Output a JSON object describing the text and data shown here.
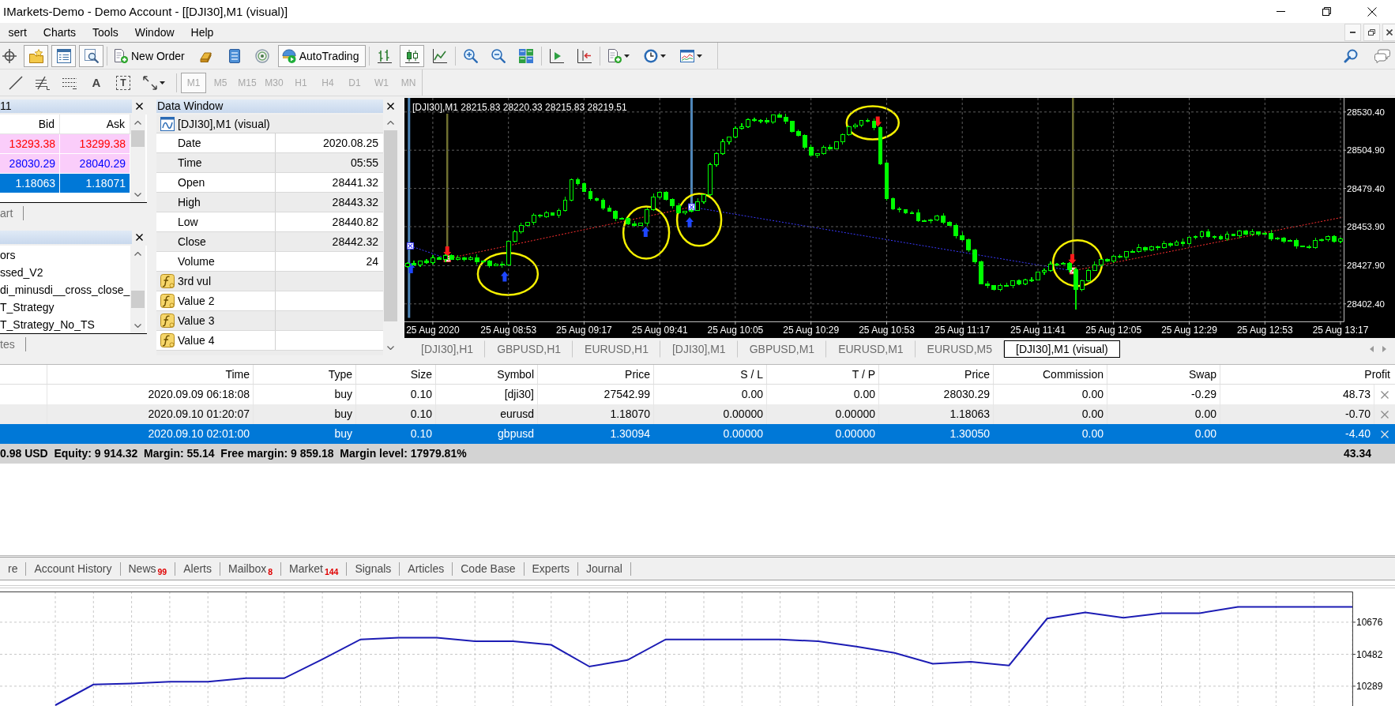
{
  "window": {
    "title": "IMarkets-Demo - Demo Account - [[DJI30],M1 (visual)]"
  },
  "menu": [
    "sert",
    "Charts",
    "Tools",
    "Window",
    "Help"
  ],
  "toolbar": [
    [
      {
        "kind": "icon",
        "pressed": false
      },
      {
        "kind": "icon",
        "pressed": true
      },
      {
        "kind": "icon",
        "pressed": true
      },
      {
        "kind": "icon",
        "pressed": true
      }
    ],
    [
      {
        "kind": "labeled",
        "label": "New Order",
        "pressed": false
      },
      {
        "kind": "icon",
        "pressed": false
      },
      {
        "kind": "icon",
        "pressed": false
      },
      {
        "kind": "icon",
        "pressed": false
      },
      {
        "kind": "labeled",
        "label": "AutoTrading",
        "pressed": true
      }
    ],
    [
      {
        "kind": "icon",
        "pressed": false
      },
      {
        "kind": "icon",
        "pressed": true
      },
      {
        "kind": "icon",
        "pressed": false
      }
    ],
    [
      {
        "kind": "icon",
        "pressed": false
      },
      {
        "kind": "icon",
        "pressed": false
      },
      {
        "kind": "icon",
        "pressed": false
      }
    ],
    [
      {
        "kind": "icon",
        "pressed": false
      },
      {
        "kind": "icon",
        "pressed": false
      }
    ],
    [
      {
        "kind": "dropdown",
        "pressed": false
      },
      {
        "kind": "dropdown",
        "pressed": false
      },
      {
        "kind": "dropdown",
        "pressed": false
      }
    ]
  ],
  "drawing_tools": [
    {
      "kind": "icon"
    },
    {
      "kind": "icon"
    },
    {
      "kind": "icon"
    },
    {
      "kind": "glyph",
      "text": "A"
    },
    {
      "kind": "boxed_glyph",
      "text": "T"
    },
    {
      "kind": "dropdown"
    }
  ],
  "periods": [
    {
      "label": "M1",
      "selected": true,
      "disabled": true
    },
    {
      "label": "M5",
      "selected": false,
      "disabled": true
    },
    {
      "label": "M15",
      "selected": false,
      "disabled": true
    },
    {
      "label": "M30",
      "selected": false,
      "disabled": true
    },
    {
      "label": "H1",
      "selected": false,
      "disabled": true
    },
    {
      "label": "H4",
      "selected": false,
      "disabled": true
    },
    {
      "label": "D1",
      "selected": false,
      "disabled": true
    },
    {
      "label": "W1",
      "selected": false,
      "disabled": true
    },
    {
      "label": "MN",
      "selected": false,
      "disabled": true
    }
  ],
  "market_watch": {
    "title": "11",
    "columns": [
      "Bid",
      "Ask"
    ],
    "rows": [
      {
        "bid": "13293.38",
        "ask": "13299.38",
        "color": "#ff0000",
        "highlighted": true,
        "selected": false
      },
      {
        "bid": "28030.29",
        "ask": "28040.29",
        "color": "#0000ff",
        "highlighted": true,
        "selected": false
      },
      {
        "bid": "1.18063",
        "ask": "1.18071",
        "selected": true
      }
    ],
    "tab": "art"
  },
  "navigator": {
    "items": [
      {
        "label": "ors",
        "selected": false
      },
      {
        "label": "ssed_V2",
        "selected": false
      },
      {
        "label": "di_minusdi__cross_close_",
        "selected": false
      },
      {
        "label": "T_Strategy",
        "selected": false
      },
      {
        "label": "T_Strategy_No_TS",
        "selected": false
      }
    ],
    "tab": "tes"
  },
  "data_window": {
    "title": "Data Window",
    "header": "[DJI30],M1 (visual)",
    "rows": [
      {
        "kind": "field",
        "name": "Date",
        "value": "2020.08.25"
      },
      {
        "kind": "field",
        "name": "Time",
        "value": "05:55"
      },
      {
        "kind": "field",
        "name": "Open",
        "value": "28441.32"
      },
      {
        "kind": "field",
        "name": "High",
        "value": "28443.32"
      },
      {
        "kind": "field",
        "name": "Low",
        "value": "28440.82"
      },
      {
        "kind": "field",
        "name": "Close",
        "value": "28442.32"
      },
      {
        "kind": "field",
        "name": "Volume",
        "value": "24"
      },
      {
        "kind": "indicator",
        "name": "3rd vul"
      },
      {
        "kind": "indicator",
        "name": "Value 2"
      },
      {
        "kind": "indicator",
        "name": "Value 3"
      },
      {
        "kind": "indicator",
        "name": "Value 4"
      }
    ]
  },
  "chart": {
    "chart_data": {
      "type": "candlestick",
      "title": "[DJI30],M1 28215.83 28220.33 28215.83 28219.51",
      "grid": true,
      "ylim": [
        28390.7,
        28539.8
      ],
      "yticks": [
        {
          "value": 28530.4,
          "label": "28530.40"
        },
        {
          "value": 28504.9,
          "label": "28504.90"
        },
        {
          "value": 28479.4,
          "label": "28479.40"
        },
        {
          "value": 28453.9,
          "label": "28453.90"
        },
        {
          "value": 28427.9,
          "label": "28427.90"
        },
        {
          "value": 28402.4,
          "label": "28402.40"
        }
      ],
      "categories": [
        null,
        null,
        null,
        null,
        "25 Aug 2020",
        null,
        null,
        null,
        null,
        null,
        null,
        null,
        null,
        null,
        null,
        null,
        "25 Aug 08:53",
        null,
        null,
        null,
        null,
        null,
        null,
        null,
        null,
        null,
        null,
        null,
        "25 Aug 09:17",
        null,
        null,
        null,
        null,
        null,
        null,
        null,
        null,
        null,
        null,
        null,
        "25 Aug 09:41",
        null,
        null,
        null,
        null,
        null,
        null,
        null,
        null,
        null,
        null,
        null,
        "25 Aug 10:05",
        null,
        null,
        null,
        null,
        null,
        null,
        null,
        null,
        null,
        null,
        null,
        "25 Aug 10:29",
        null,
        null,
        null,
        null,
        null,
        null,
        null,
        null,
        null,
        null,
        null,
        "25 Aug 10:53",
        null,
        null,
        null,
        null,
        null,
        null,
        null,
        null,
        null,
        null,
        null,
        "25 Aug 11:17",
        null,
        null,
        null,
        null,
        null,
        null,
        null,
        null,
        null,
        null,
        null,
        "25 Aug 11:41",
        null,
        null,
        null,
        null,
        null,
        null,
        null,
        null,
        null,
        null,
        null,
        "25 Aug 12:05",
        null,
        null,
        null,
        null,
        null,
        null,
        null,
        null,
        null,
        null,
        null,
        "25 Aug 12:29",
        null,
        null,
        null,
        null,
        null,
        null,
        null,
        null,
        null,
        null,
        null,
        "25 Aug 12:53",
        null,
        null,
        null,
        null,
        null,
        null,
        null,
        null,
        null,
        null,
        null,
        "25 Aug 13:17"
      ],
      "ohlc": [
        [
          28427.5,
          28430.4,
          28426.4,
          28429.6
        ],
        [
          28429.6,
          28431.2,
          28428.1,
          28428.6
        ],
        [
          28428.6,
          28431.5,
          28426.9,
          28431.1
        ],
        [
          28431.1,
          28432.3,
          28429.2,
          28430.0
        ],
        [
          28430.0,
          28435.2,
          28428.7,
          28433.1
        ],
        [
          28433.1,
          28433.7,
          28431.8,
          28432.2
        ],
        [
          28432.2,
          28435.5,
          28430.3,
          28434.5
        ],
        [
          28434.5,
          28435.3,
          28431.6,
          28432.3
        ],
        [
          28432.3,
          28434.9,
          28431.3,
          28433.3
        ],
        [
          28433.3,
          28433.7,
          28430.8,
          28431.9
        ],
        [
          28431.9,
          28434.6,
          28431.4,
          28433.4
        ],
        [
          28433.4,
          28435.5,
          28428.7,
          28430.4
        ],
        [
          28430.4,
          28431.5,
          28429.6,
          28430.9
        ],
        [
          28430.9,
          28431.9,
          28426.6,
          28427.9
        ],
        [
          28427.9,
          28429.9,
          28427.5,
          28429.1
        ],
        [
          28429.1,
          28430.7,
          28426.3,
          28428.2
        ],
        [
          28428.2,
          28444.7,
          28427.5,
          28444.3
        ],
        [
          28444.3,
          28451.7,
          28443.3,
          28450.5
        ],
        [
          28450.5,
          28456.6,
          28449.4,
          28454.5
        ],
        [
          28454.5,
          28457.2,
          28454.0,
          28456.6
        ],
        [
          28456.6,
          28462.7,
          28454.9,
          28461.7
        ],
        [
          28461.7,
          28462.5,
          28460.0,
          28460.8
        ],
        [
          28460.8,
          28464.6,
          28459.5,
          28463.0
        ],
        [
          28463.0,
          28463.4,
          28461.3,
          28461.7
        ],
        [
          28461.7,
          28466.0,
          28459.8,
          28464.8
        ],
        [
          28464.8,
          28473.9,
          28464.1,
          28471.8
        ],
        [
          28471.8,
          28486.1,
          28470.8,
          28485.5
        ],
        [
          28485.5,
          28486.5,
          28481.6,
          28482.7
        ],
        [
          28482.7,
          28483.5,
          28477.1,
          28477.6
        ],
        [
          28477.6,
          28479.2,
          28471.2,
          28472.9
        ],
        [
          28472.9,
          28473.3,
          28470.9,
          28471.7
        ],
        [
          28471.7,
          28472.9,
          28465.0,
          28466.3
        ],
        [
          28466.3,
          28468.4,
          28464.0,
          28464.4
        ],
        [
          28464.4,
          28465.0,
          28457.4,
          28459.3
        ],
        [
          28459.3,
          28460.4,
          28458.6,
          28459.4
        ],
        [
          28459.4,
          28460.2,
          28454.8,
          28455.8
        ],
        [
          28455.8,
          28457.4,
          28453.8,
          28454.9
        ],
        [
          28454.9,
          28456.8,
          28454.4,
          28456.4
        ],
        [
          28456.4,
          28466.6,
          28454.7,
          28465.4
        ],
        [
          28465.4,
          28475.9,
          28464.6,
          28473.8
        ],
        [
          28473.8,
          28477.5,
          28472.5,
          28476.9
        ],
        [
          28476.9,
          28477.9,
          28471.5,
          28471.9
        ],
        [
          28471.9,
          28472.7,
          28466.2,
          28468.1
        ],
        [
          28468.1,
          28469.7,
          28462.4,
          28463.1
        ],
        [
          28463.1,
          28464.7,
          28462.1,
          28464.3
        ],
        [
          28464.3,
          28466.2,
          28463.2,
          28465.0
        ],
        [
          28465.0,
          28472.9,
          28464.5,
          28470.8
        ],
        [
          28470.8,
          28475.8,
          28469.1,
          28475.2
        ],
        [
          28475.2,
          28496.4,
          28474.4,
          28495.4
        ],
        [
          28495.4,
          28503.3,
          28494.1,
          28502.5
        ],
        [
          28502.5,
          28512.3,
          28502.1,
          28510.7
        ],
        [
          28510.7,
          28514.2,
          28508.8,
          28513.8
        ],
        [
          28513.8,
          28520.7,
          28513.1,
          28519.5
        ],
        [
          28519.5,
          28522.8,
          28518.5,
          28520.7
        ],
        [
          28520.7,
          28526.0,
          28519.6,
          28525.4
        ],
        [
          28525.4,
          28526.4,
          28524.1,
          28524.6
        ],
        [
          28524.6,
          28525.8,
          28522.9,
          28525.0
        ],
        [
          28525.0,
          28526.6,
          28522.7,
          28523.5
        ],
        [
          28523.5,
          28528.9,
          28522.2,
          28528.5
        ],
        [
          28528.5,
          28529.7,
          28526.6,
          28527.0
        ],
        [
          28527.0,
          28529.1,
          28522.3,
          28524.2
        ],
        [
          28524.2,
          28524.8,
          28516.9,
          28517.6
        ],
        [
          28517.6,
          28518.6,
          28513.8,
          28514.8
        ],
        [
          28514.8,
          28515.6,
          28505.8,
          28506.9
        ],
        [
          28506.9,
          28508.5,
          28501.0,
          28501.5
        ],
        [
          28501.5,
          28503.2,
          28499.8,
          28502.8
        ],
        [
          28502.8,
          28508.0,
          28502.0,
          28506.8
        ],
        [
          28506.8,
          28508.9,
          28504.5,
          28505.8
        ],
        [
          28505.8,
          28511.1,
          28505.4,
          28510.5
        ],
        [
          28510.5,
          28516.2,
          28508.6,
          28515.2
        ],
        [
          28515.2,
          28521.3,
          28514.5,
          28520.5
        ],
        [
          28520.5,
          28523.2,
          28519.5,
          28521.6
        ],
        [
          28521.6,
          28525.1,
          28520.5,
          28524.7
        ],
        [
          28524.7,
          28525.9,
          28523.7,
          28524.2
        ],
        [
          28524.2,
          28526.3,
          28518.4,
          28520.1
        ],
        [
          28520.1,
          28520.7,
          28495.3,
          28496.1
        ],
        [
          28496.1,
          28497.1,
          28471.4,
          28472.7
        ],
        [
          28472.7,
          28473.5,
          28465.2,
          28465.6
        ],
        [
          28465.6,
          28467.2,
          28463.3,
          28465.2
        ],
        [
          28465.2,
          28465.6,
          28462.5,
          28463.2
        ],
        [
          28463.2,
          28464.6,
          28462.2,
          28463.4
        ],
        [
          28463.4,
          28465.5,
          28457.0,
          28458.1
        ],
        [
          28458.1,
          28458.7,
          28457.5,
          28458.0
        ],
        [
          28458.0,
          28459.2,
          28456.3,
          28458.2
        ],
        [
          28458.2,
          28461.9,
          28457.4,
          28461.1
        ],
        [
          28461.1,
          28462.7,
          28455.7,
          28457.0
        ],
        [
          28457.0,
          28457.4,
          28454.5,
          28454.9
        ],
        [
          28454.9,
          28456.1,
          28446.2,
          28448.1
        ],
        [
          28448.1,
          28450.2,
          28444.5,
          28445.2
        ],
        [
          28445.2,
          28445.8,
          28437.3,
          28438.3
        ],
        [
          28438.3,
          28439.3,
          28429.4,
          28430.5
        ],
        [
          28430.5,
          28431.3,
          28415.4,
          28415.9
        ],
        [
          28415.9,
          28417.5,
          28413.0,
          28414.7
        ],
        [
          28414.7,
          28415.1,
          28411.5,
          28412.3
        ],
        [
          28412.3,
          28415.8,
          28411.0,
          28414.6
        ],
        [
          28414.6,
          28416.7,
          28414.1,
          28414.5
        ],
        [
          28414.5,
          28418.2,
          28412.6,
          28417.6
        ],
        [
          28417.6,
          28418.6,
          28415.2,
          28415.9
        ],
        [
          28415.9,
          28419.0,
          28414.9,
          28418.2
        ],
        [
          28418.2,
          28420.1,
          28417.1,
          28418.5
        ],
        [
          28418.5,
          28424.0,
          28418.0,
          28423.6
        ],
        [
          28423.6,
          28425.8,
          28421.9,
          28424.6
        ],
        [
          28424.6,
          28431.0,
          28423.8,
          28428.9
        ],
        [
          28428.9,
          28429.5,
          28427.5,
          28428.8
        ],
        [
          28428.8,
          28430.5,
          28428.4,
          28429.5
        ],
        [
          28429.5,
          28430.3,
          28423.2,
          28425.1
        ],
        [
          28425.1,
          28426.7,
          28398.5,
          28412.0
        ],
        [
          28412.0,
          28418.4,
          28411.0,
          28418.0
        ],
        [
          28418.0,
          28425.9,
          28416.9,
          28424.7
        ],
        [
          28424.7,
          28430.7,
          28424.2,
          28428.6
        ],
        [
          28428.6,
          28432.5,
          28426.9,
          28431.9
        ],
        [
          28431.9,
          28432.9,
          28430.4,
          28431.2
        ],
        [
          28431.2,
          28434.9,
          28429.9,
          28434.1
        ],
        [
          28434.1,
          28435.7,
          28433.1,
          28433.5
        ],
        [
          28433.5,
          28437.7,
          28431.6,
          28437.3
        ],
        [
          28437.3,
          28438.6,
          28436.6,
          28437.4
        ],
        [
          28437.4,
          28442.1,
          28436.4,
          28440.0
        ],
        [
          28440.0,
          28440.6,
          28437.1,
          28438.2
        ],
        [
          28438.2,
          28441.3,
          28437.7,
          28440.3
        ],
        [
          28440.3,
          28441.1,
          28438.3,
          28440.0
        ],
        [
          28440.0,
          28444.4,
          28439.2,
          28442.8
        ],
        [
          28442.8,
          28443.2,
          28440.2,
          28441.5
        ],
        [
          28441.5,
          28445.1,
          28441.1,
          28443.9
        ],
        [
          28443.9,
          28446.0,
          28440.8,
          28442.7
        ],
        [
          28442.7,
          28447.3,
          28442.0,
          28446.7
        ],
        [
          28446.7,
          28448.1,
          28445.7,
          28447.1
        ],
        [
          28447.1,
          28451.5,
          28446.0,
          28450.7
        ],
        [
          28450.7,
          28452.3,
          28446.6,
          28447.1
        ],
        [
          28447.1,
          28448.0,
          28445.4,
          28447.6
        ],
        [
          28447.6,
          28448.8,
          28444.8,
          28445.6
        ],
        [
          28445.6,
          28450.8,
          28444.3,
          28448.7
        ],
        [
          28448.7,
          28449.3,
          28447.6,
          28448.0
        ],
        [
          28448.0,
          28452.0,
          28446.1,
          28451.0
        ],
        [
          28451.0,
          28451.8,
          28448.0,
          28448.7
        ],
        [
          28448.7,
          28452.2,
          28447.7,
          28450.6
        ],
        [
          28450.6,
          28451.0,
          28447.7,
          28448.8
        ],
        [
          28448.8,
          28450.9,
          28448.3,
          28449.7
        ],
        [
          28449.7,
          28451.8,
          28444.3,
          28446.0
        ],
        [
          28446.0,
          28446.9,
          28445.2,
          28446.3
        ],
        [
          28446.3,
          28447.3,
          28443.0,
          28444.3
        ],
        [
          28444.3,
          28445.4,
          28443.9,
          28444.6
        ],
        [
          28444.6,
          28446.2,
          28439.0,
          28440.9
        ],
        [
          28440.9,
          28441.3,
          28440.0,
          28440.7
        ],
        [
          28440.7,
          28441.9,
          28439.1,
          28440.1
        ],
        [
          28440.1,
          28446.6,
          28439.0,
          28444.5
        ],
        [
          28444.5,
          28446.0,
          28444.0,
          28445.4
        ],
        [
          28445.4,
          28448.3,
          28443.7,
          28447.3
        ],
        [
          28447.3,
          28448.1,
          28443.5,
          28444.3
        ],
        [
          28444.3,
          28446.5,
          28443.1,
          28445.8
        ]
      ]
    }
  },
  "chart_tabs": [
    {
      "label": "[DJI30],H1",
      "selected": false
    },
    {
      "label": "GBPUSD,H1",
      "selected": false
    },
    {
      "label": "EURUSD,H1",
      "selected": false
    },
    {
      "label": "[DJI30],M1",
      "selected": false
    },
    {
      "label": "GBPUSD,M1",
      "selected": false
    },
    {
      "label": "EURUSD,M1",
      "selected": false
    },
    {
      "label": "EURUSD,M5",
      "selected": false
    },
    {
      "label": "[DJI30],M1 (visual)",
      "selected": true
    }
  ],
  "terminal": {
    "columns": [
      "Time",
      "Type",
      "Size",
      "Symbol",
      "Price",
      "S / L",
      "T / P",
      "Price",
      "Commission",
      "Swap",
      "Profit"
    ],
    "rows": [
      {
        "cells": [
          "2020.09.09 06:18:08",
          "buy",
          "0.10",
          "[dji30]",
          "27542.99",
          "0.00",
          "0.00",
          "28030.29",
          "0.00",
          "-0.29",
          "48.73"
        ],
        "selected": false
      },
      {
        "cells": [
          "2020.09.10 01:20:07",
          "buy",
          "0.10",
          "eurusd",
          "1.18070",
          "0.00000",
          "0.00000",
          "1.18063",
          "0.00",
          "0.00",
          "-0.70"
        ],
        "selected": false
      },
      {
        "cells": [
          "2020.09.10 02:01:00",
          "buy",
          "0.10",
          "gbpusd",
          "1.30094",
          "0.00000",
          "0.00000",
          "1.30050",
          "0.00",
          "0.00",
          "-4.40"
        ],
        "selected": true
      }
    ],
    "summary": "0.98 USD  Equity: 9 914.32  Margin: 55.14  Free margin: 9 859.18  Margin level: 17979.81%",
    "total": "43.34"
  },
  "terminal_tabs": [
    {
      "label": "re",
      "selected": false
    },
    {
      "label": "Account History",
      "selected": false
    },
    {
      "label": "News",
      "badge": "99",
      "selected": false
    },
    {
      "label": "Alerts",
      "selected": false
    },
    {
      "label": "Mailbox",
      "badge": "8",
      "selected": false
    },
    {
      "label": "Market",
      "badge": "144",
      "selected": false
    },
    {
      "label": "Signals",
      "selected": false
    },
    {
      "label": "Articles",
      "selected": false
    },
    {
      "label": "Code Base",
      "selected": false
    },
    {
      "label": "Experts",
      "selected": false
    },
    {
      "label": "Journal",
      "selected": false
    }
  ],
  "tester_graph": {
    "chart_data": {
      "type": "line",
      "grid": true,
      "yticks": [
        10289,
        10482,
        10676
      ],
      "ylim": [
        10169,
        10862
      ],
      "series": [
        {
          "color": "#1c1cb4",
          "values": [
            10174,
            10299,
            10305,
            10316,
            10316,
            10337,
            10337,
            10452,
            10572,
            10583,
            10583,
            10561,
            10561,
            10539,
            10408,
            10447,
            10572,
            10572,
            10572,
            10572,
            10561,
            10529,
            10490,
            10425,
            10436,
            10414,
            10698,
            10736,
            10703,
            10731,
            10731,
            10769,
            10769,
            10769,
            10769
          ]
        }
      ]
    }
  }
}
